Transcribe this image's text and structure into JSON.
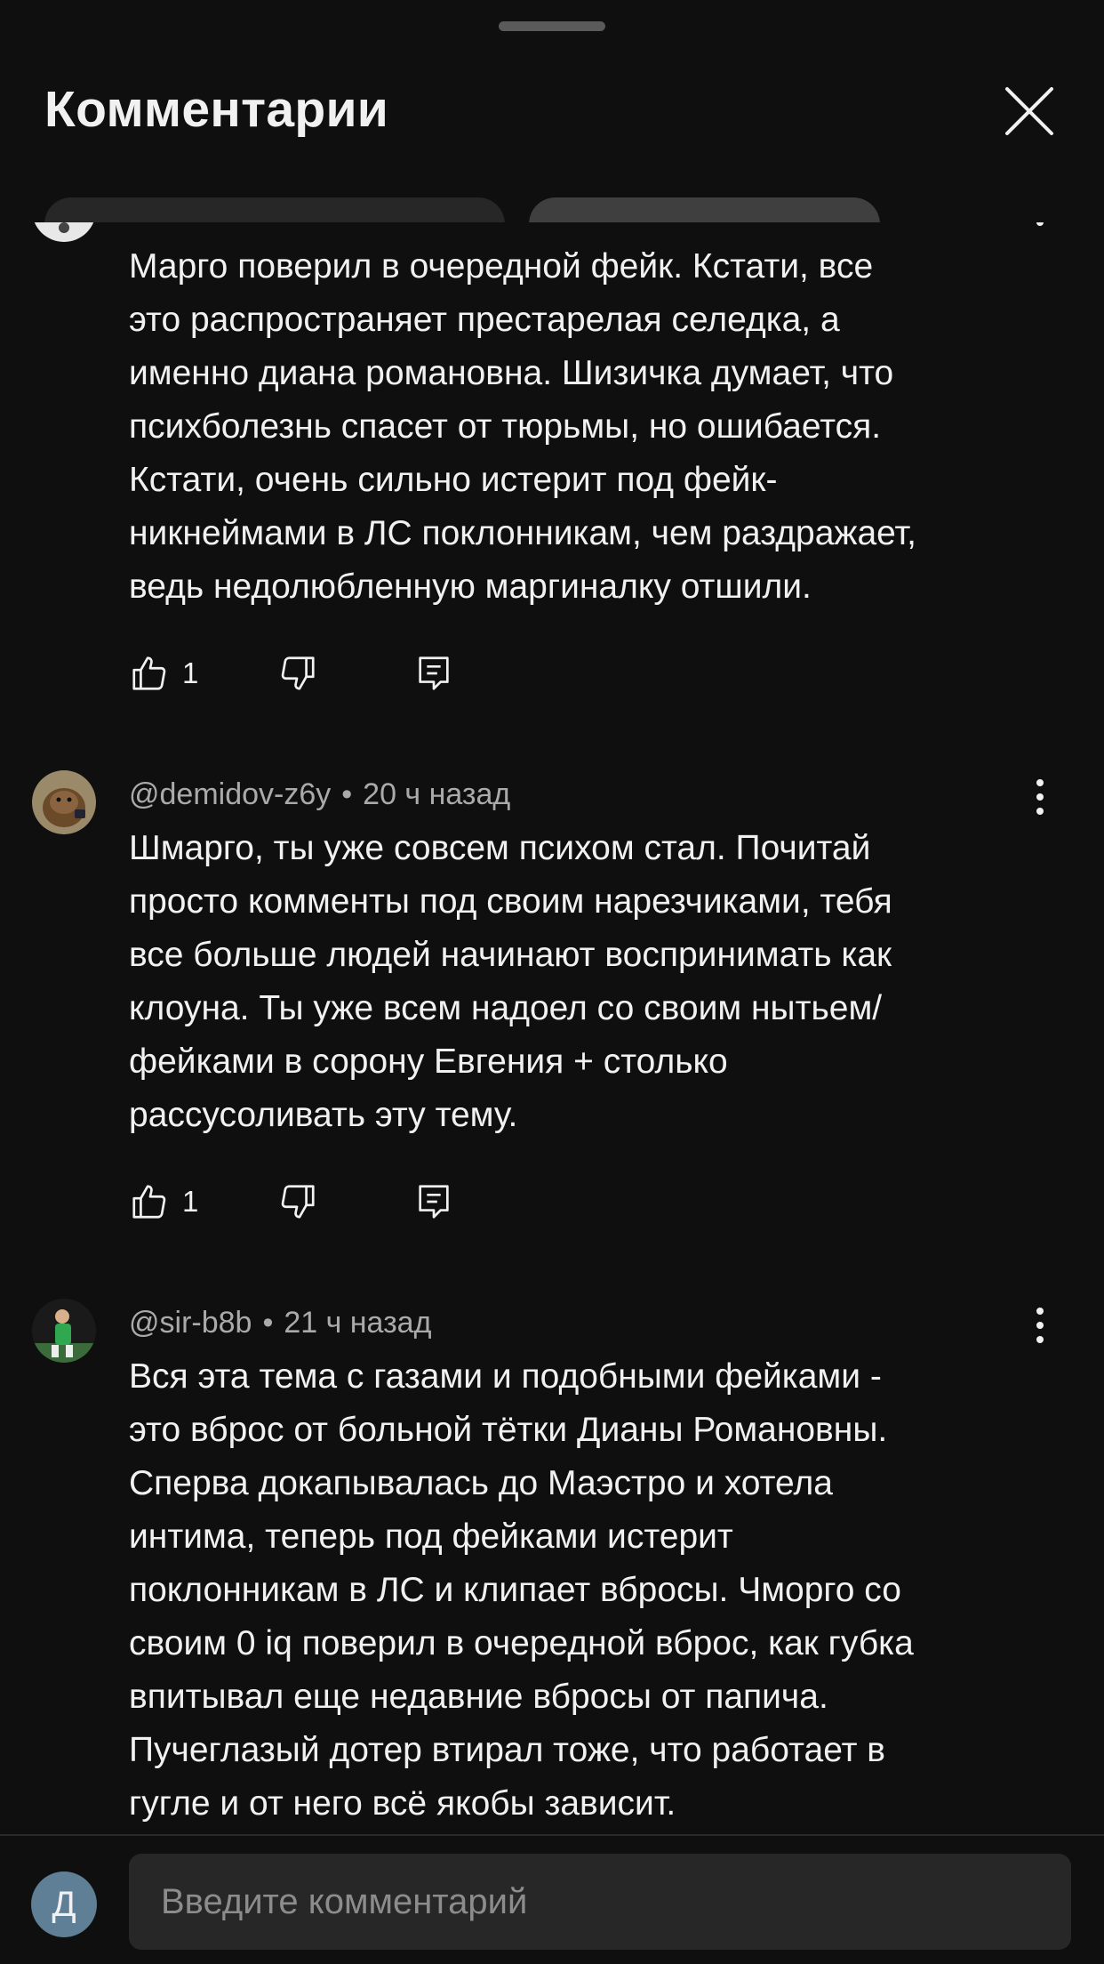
{
  "header": {
    "title": "Комментарии"
  },
  "comments": [
    {
      "author": "",
      "time": "",
      "lines": [
        "Марго поверил в очередной фейк. Кстати, все",
        "это распространяет престарелая селедка, а",
        "именно диана романовна. Шизичка думает, что",
        "психболезнь спасет от тюрьмы, но ошибается.",
        "Кстати, очень сильно истерит под фейк-",
        "никнеймами в ЛС поклонникам, чем раздражает,",
        "ведь недолюбленную маргиналку отшили."
      ],
      "likes": "1"
    },
    {
      "author": "@demidov-z6y",
      "separator": "•",
      "time": "20 ч назад",
      "lines": [
        "Шмарго, ты уже совсем психом стал. Почитай",
        "просто комменты под своим нарезчиками, тебя",
        "все больше людей начинают воспринимать как",
        "клоуна. Ты уже всем надоел со своим нытьем/",
        "фейками в сорону Евгения + столько",
        "рассусоливать эту тему."
      ],
      "likes": "1"
    },
    {
      "author": "@sir-b8b",
      "separator": "•",
      "time": "21 ч назад",
      "lines": [
        "Вся эта тема с газами и подобными фейками -",
        "это вброс от больной тётки Дианы Романовны.",
        "Сперва докапывалась до Маэстро и хотела",
        "интима, теперь под фейками истерит",
        "поклонникам в ЛС и клипает вбросы. Чморго со",
        "своим 0 iq поверил в очередной вброс, как губка",
        "впитывал еще недавние вбросы от папича.",
        "Пучеглазый дотер втирал тоже, что работает в",
        "гугле и от него всё якобы зависит."
      ]
    }
  ],
  "footer": {
    "avatar_letter": "Д",
    "input_placeholder": "Введите комментарий"
  },
  "icons": {
    "close": "close-icon",
    "like": "thumb-up-icon",
    "dislike": "thumb-down-icon",
    "reply": "reply-comment-icon",
    "more": "more-vertical-icon"
  },
  "colors": {
    "background": "#0f0f0f",
    "text": "#f1f1f1",
    "meta": "#aaaaaa",
    "input_bg": "#272727",
    "avatar_bg": "#5e7f95"
  }
}
